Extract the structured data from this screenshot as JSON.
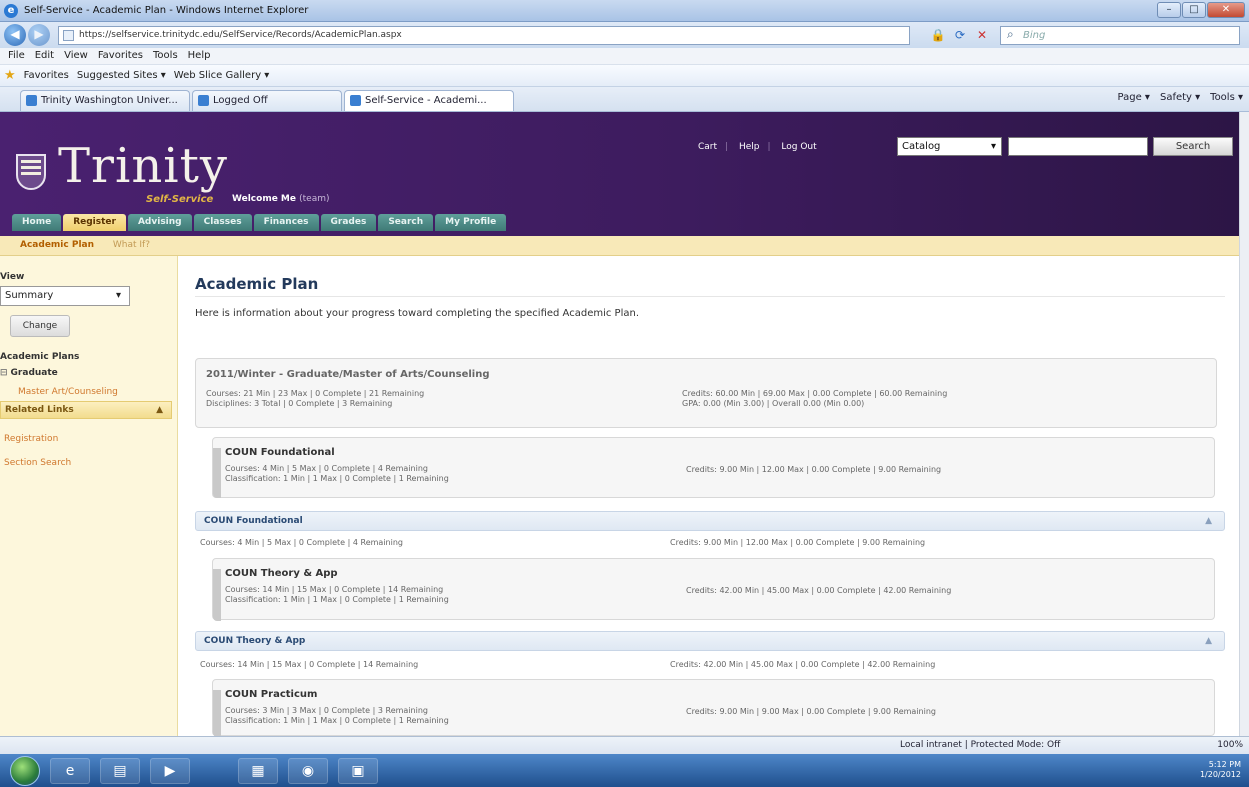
{
  "browser": {
    "title": "Self-Service - Academic Plan - Windows Internet Explorer",
    "url": "https://selfservice.trinitydc.edu/SelfService/Records/AcademicPlan.aspx",
    "search_placeholder": "Bing",
    "menu": [
      "File",
      "Edit",
      "View",
      "Favorites",
      "Tools",
      "Help"
    ],
    "favorites_label": "Favorites",
    "favorites_items": [
      "Suggested Sites ▾",
      "Web Slice Gallery ▾"
    ],
    "tabs": [
      "Trinity Washington Univer...",
      "Logged Off",
      "Self-Service - Academi..."
    ],
    "commands": [
      "Page ▾",
      "Safety ▾",
      "Tools ▾"
    ]
  },
  "header": {
    "logo": "Trinity",
    "selfservice": "Self-Service",
    "welcome": "Welcome Me",
    "welcome_suffix": "(team)",
    "links": [
      "Cart",
      "Help",
      "Log Out"
    ],
    "catalog_select": "Catalog",
    "search_button": "Search"
  },
  "nav": {
    "tabs": [
      "Home",
      "Register",
      "Advising",
      "Classes",
      "Finances",
      "Grades",
      "Search",
      "My Profile"
    ],
    "active_tab": "Register",
    "subnav_active": "Academic Plan",
    "subnav_other": "What If?"
  },
  "sidebar": {
    "view_label": "View",
    "view_value": "Summary",
    "change_button": "Change",
    "plans_label": "Academic Plans",
    "graduate_label": "Graduate",
    "plan_link": "Master Art/Counseling",
    "related_links": "Related Links",
    "rel_links": [
      "Registration",
      "Section Search"
    ]
  },
  "main": {
    "title": "Academic Plan",
    "intro": "Here is information about your progress toward completing the specified Academic Plan.",
    "plan": {
      "title": "2011/Winter - Graduate/Master of Arts/Counseling",
      "line1_left": "Courses: 21 Min | 23 Max | 0 Complete | 21 Remaining",
      "line2_left": "Disciplines: 3 Total | 0 Complete | 3 Remaining",
      "line1_right": "Credits: 60.00 Min | 69.00 Max | 0.00 Complete | 60.00 Remaining",
      "line2_right": "GPA: 0.00 (Min 3.00) | Overall 0.00 (Min 0.00)"
    },
    "disc1": {
      "title": "COUN Foundational",
      "line1": "Courses: 4 Min | 5 Max | 0 Complete | 4 Remaining",
      "line2": "Classification: 1 Min | 1 Max | 0 Complete | 1 Remaining",
      "credits": "Credits: 9.00 Min | 12.00 Max | 0.00 Complete | 9.00 Remaining"
    },
    "sect1": {
      "title": "COUN Foundational",
      "courses": "Courses: 4 Min | 5 Max | 0 Complete | 4 Remaining",
      "credits": "Credits: 9.00 Min | 12.00 Max | 0.00 Complete | 9.00 Remaining"
    },
    "disc2": {
      "title": "COUN Theory & App",
      "line1": "Courses: 14 Min | 15 Max | 0 Complete | 14 Remaining",
      "line2": "Classification: 1 Min | 1 Max | 0 Complete | 1 Remaining",
      "credits": "Credits: 42.00 Min | 45.00 Max | 0.00 Complete | 42.00 Remaining"
    },
    "sect2": {
      "title": "COUN Theory & App",
      "courses": "Courses: 14 Min | 15 Max | 0 Complete | 14 Remaining",
      "credits": "Credits: 42.00 Min | 45.00 Max | 0.00 Complete | 42.00 Remaining"
    },
    "disc3": {
      "title": "COUN Practicum",
      "line1": "Courses: 3 Min | 3 Max | 0 Complete | 3 Remaining",
      "line2": "Classification: 1 Min | 1 Max | 0 Complete | 1 Remaining",
      "credits": "Credits: 9.00 Min | 9.00 Max | 0.00 Complete | 9.00 Remaining"
    }
  },
  "status": {
    "zone": "Local intranet | Protected Mode: Off",
    "zoom": "100%",
    "clock_time": "5:12 PM",
    "clock_date": "1/20/2012"
  }
}
